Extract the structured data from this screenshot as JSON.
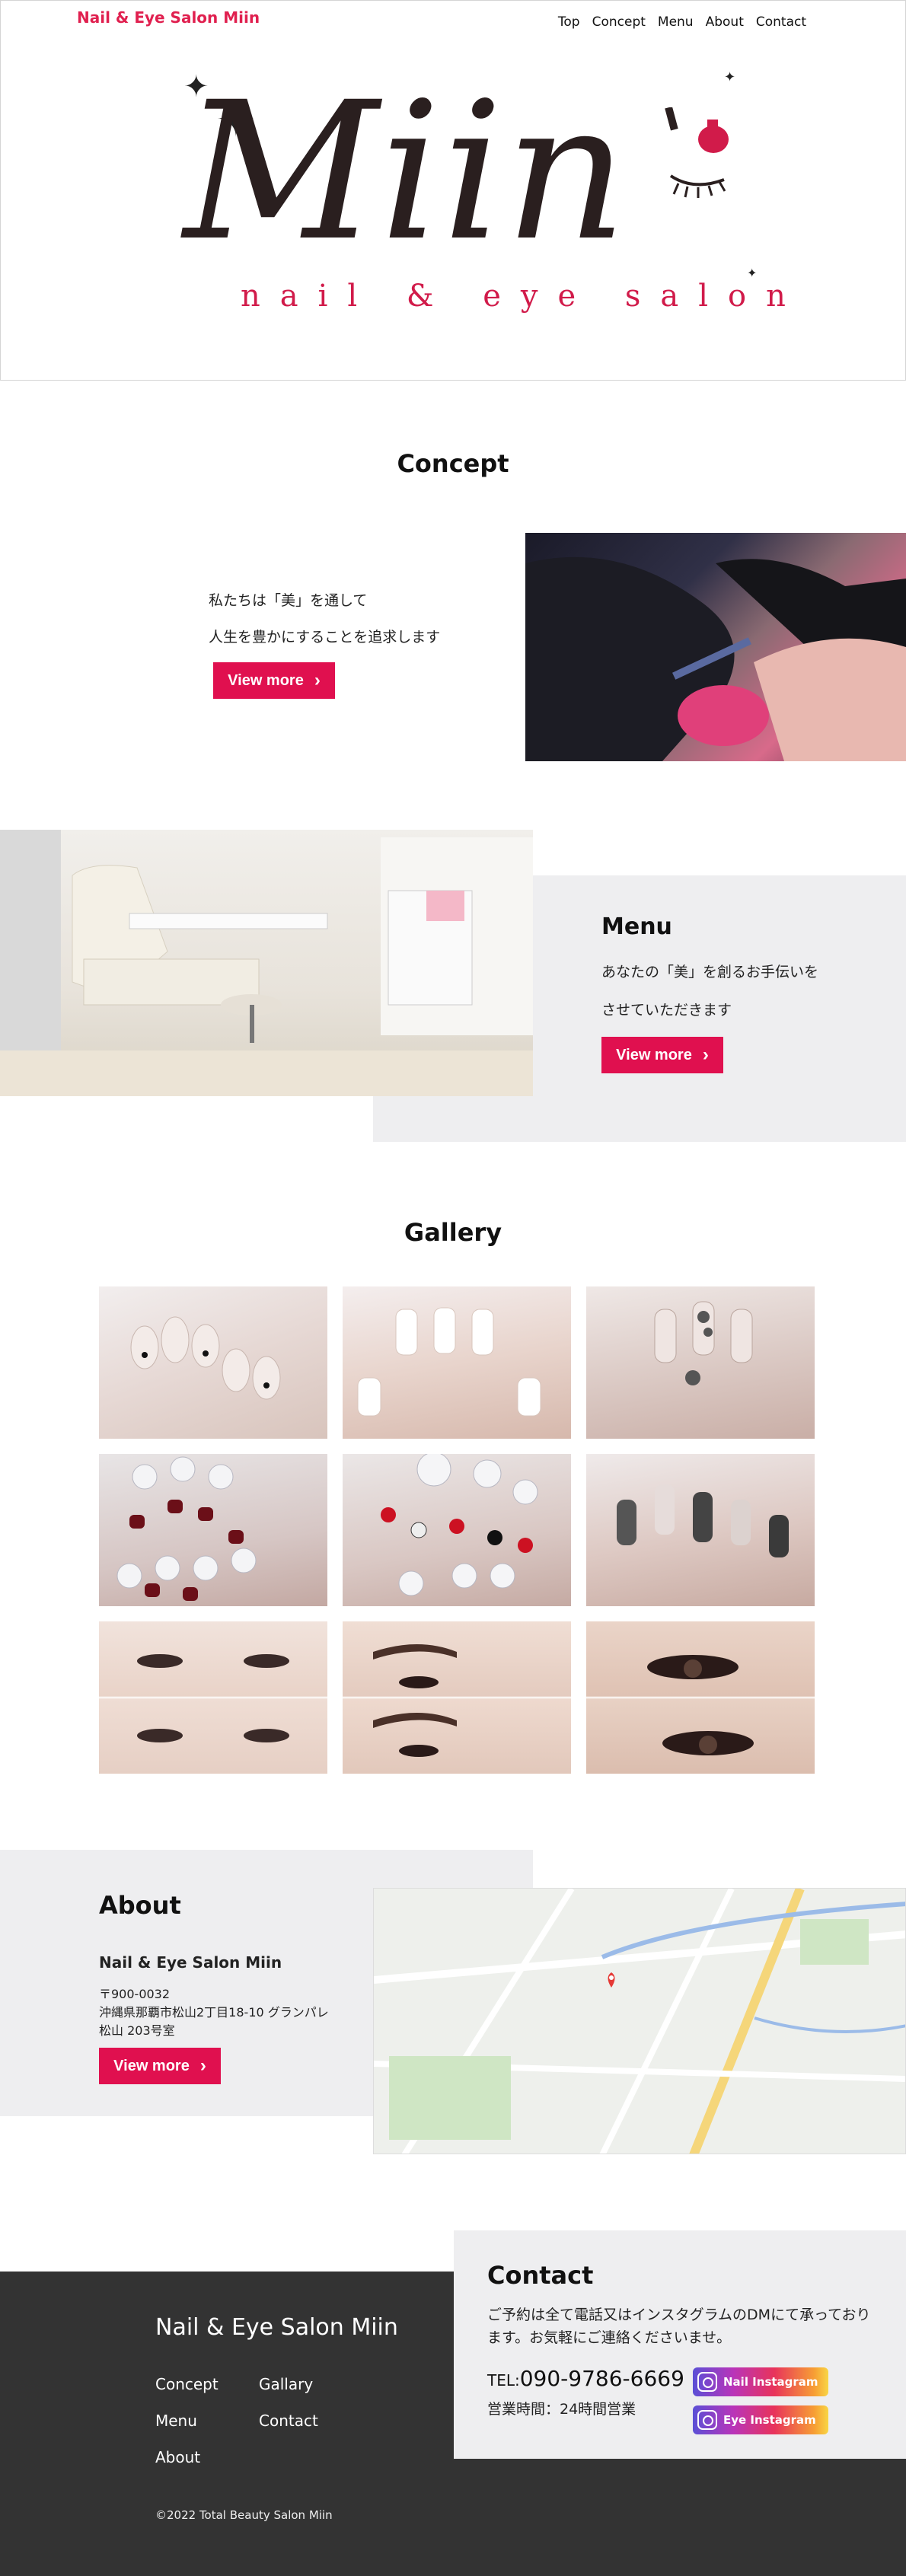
{
  "header": {
    "brand": "Nail & Eye Salon Miin",
    "nav": [
      "Top",
      "Concept",
      "Menu",
      "About",
      "Contact"
    ]
  },
  "hero": {
    "logo_word": "Miin",
    "logo_sub": "nail & eye salon"
  },
  "concept": {
    "title": "Concept",
    "line1": "私たちは「美」を通して",
    "line2": "人生を豊かにすることを追求します",
    "button": "View more"
  },
  "menu": {
    "title": "Menu",
    "line1": "あなたの「美」を創るお手伝いを",
    "line2": "させていただきます",
    "button": "View more"
  },
  "gallery": {
    "title": "Gallery"
  },
  "about": {
    "title": "About",
    "name": "Nail & Eye Salon Miin",
    "postal": "〒900-0032",
    "address1": "沖縄県那覇市松山2丁目18-10 グランパレ",
    "address2": "松山 203号室",
    "button": "View more"
  },
  "footer": {
    "brand": "Nail & Eye Salon Miin",
    "links": [
      "Concept",
      "Gallary",
      "Menu",
      "Contact",
      "About"
    ],
    "copyright": "©2022 Total Beauty Salon Miin"
  },
  "contact": {
    "title": "Contact",
    "text": "ご予約は全て電話又はインスタグラムのDMにて承っております。お気軽にご連絡くださいませ。",
    "tel_label": "TEL:",
    "tel": "090-9786-6669",
    "hours": "営業時間：24時間営業",
    "ig_nail": "Nail Instagram",
    "ig_eye": "Eye Instagram"
  },
  "colors": {
    "accent": "#e0104f",
    "panel": "#eeeef0",
    "footer": "#333333"
  }
}
